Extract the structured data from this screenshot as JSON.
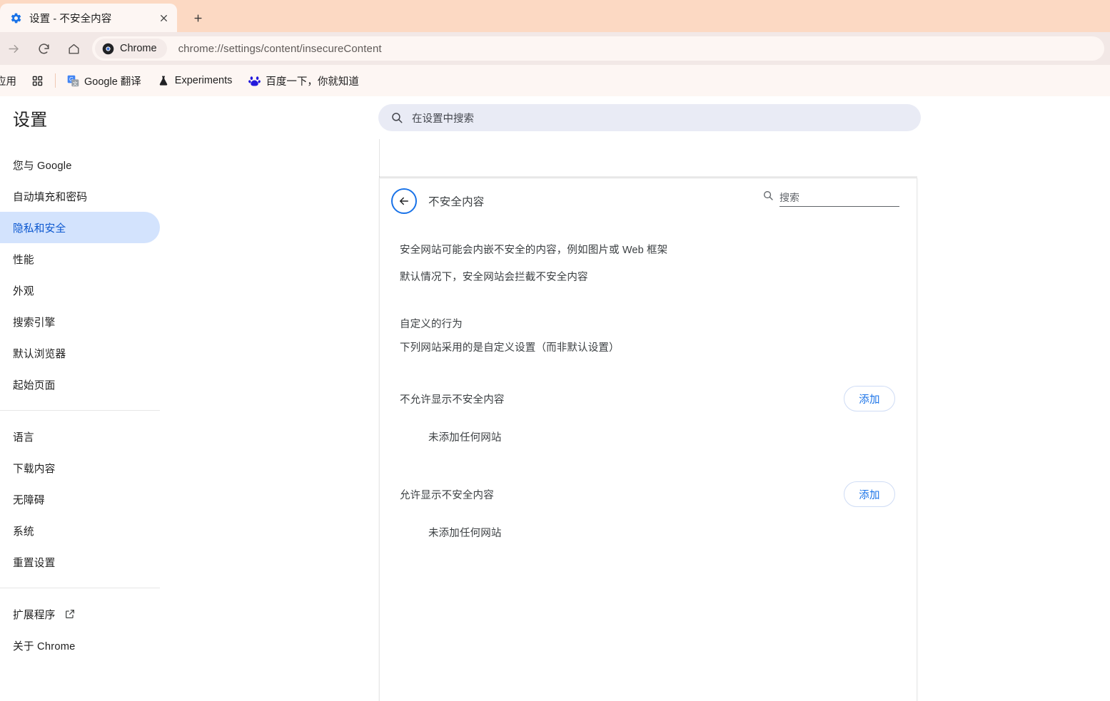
{
  "colors": {
    "tabstrip_bg": "#fcd9c3",
    "toolbar_bg": "#f2e8e6",
    "bookmarkbar_bg": "#fdf6f3",
    "accent_blue": "#1a73e8",
    "selected_pill": "#d3e3fd",
    "selected_text": "#0b57d0",
    "search_bg": "#e9ebf5"
  },
  "browser": {
    "tab": {
      "title": "设置 - 不安全内容",
      "favicon_name": "settings-gear-icon",
      "close_label": "×"
    },
    "newtab_label": "+",
    "nav": {
      "forward_name": "forward-arrow-icon",
      "reload_name": "reload-icon",
      "home_name": "home-icon"
    },
    "omnibox": {
      "chip_label": "Chrome",
      "chip_icon_name": "chrome-logo-icon",
      "url": "chrome://settings/content/insecureContent"
    },
    "bookmarks": {
      "apps_label": "应用",
      "grid_icon_name": "apps-grid-icon",
      "items": [
        {
          "label": "Google 翻译",
          "icon_name": "google-translate-icon"
        },
        {
          "label": "Experiments",
          "icon_name": "flask-icon"
        },
        {
          "label": "百度一下，你就知道",
          "icon_name": "baidu-paw-icon"
        }
      ]
    }
  },
  "settings": {
    "header": {
      "title": "设置",
      "search_placeholder": "在设置中搜索",
      "search_icon_name": "search-icon"
    },
    "sidebar": {
      "group1": [
        {
          "label": "您与 Google",
          "selected": false
        },
        {
          "label": "自动填充和密码",
          "selected": false
        },
        {
          "label": "隐私和安全",
          "selected": true
        },
        {
          "label": "性能",
          "selected": false
        },
        {
          "label": "外观",
          "selected": false
        },
        {
          "label": "搜索引擎",
          "selected": false
        },
        {
          "label": "默认浏览器",
          "selected": false
        },
        {
          "label": "起始页面",
          "selected": false
        }
      ],
      "group2": [
        {
          "label": "语言",
          "selected": false
        },
        {
          "label": "下载内容",
          "selected": false
        },
        {
          "label": "无障碍",
          "selected": false
        },
        {
          "label": "系统",
          "selected": false
        },
        {
          "label": "重置设置",
          "selected": false
        }
      ],
      "group3": [
        {
          "label": "扩展程序",
          "external": true,
          "icon_name": "external-link-icon"
        },
        {
          "label": "关于 Chrome",
          "external": false
        }
      ]
    },
    "subpage": {
      "back_icon_name": "back-arrow-icon",
      "title": "不安全内容",
      "search_placeholder": "搜索",
      "search_icon_name": "search-icon",
      "description_lines": [
        "安全网站可能会内嵌不安全的内容，例如图片或 Web 框架",
        "默认情况下，安全网站会拦截不安全内容"
      ],
      "custom_behavior_heading": "自定义的行为",
      "custom_behavior_sub": "下列网站采用的是自定义设置（而非默认设置）",
      "permission_groups": [
        {
          "label": "不允许显示不安全内容",
          "add_label": "添加",
          "empty_text": "未添加任何网站"
        },
        {
          "label": "允许显示不安全内容",
          "add_label": "添加",
          "empty_text": "未添加任何网站"
        }
      ]
    }
  }
}
